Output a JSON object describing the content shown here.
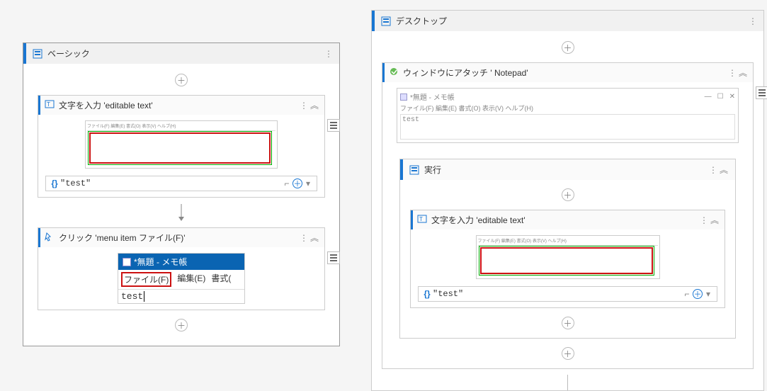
{
  "left": {
    "title": "ベーシック",
    "type_text": {
      "title": "文字を入力 'editable text'",
      "preview_menu": "ファイル(F)  編集(E)  書式(O)  表示(V)  ヘルプ(H)",
      "value": "\"test\""
    },
    "click": {
      "title": "クリック 'menu item  ファイル(F)'",
      "notepad_title": "*無題 - メモ帳",
      "menu_file": "ファイル(F)",
      "menu_edit": "編集(E)",
      "menu_format": "書式(",
      "body_text": "test"
    }
  },
  "right": {
    "title": "デスクトップ",
    "attach": {
      "title": "ウィンドウにアタッチ '      Notepad'",
      "np_title": "*無題 - メモ帳",
      "np_menu": "ファイル(F)  編集(E)  書式(O)  表示(V)  ヘルプ(H)",
      "np_body": "test"
    },
    "exec": {
      "title": "実行",
      "type_text": {
        "title": "文字を入力 'editable text'",
        "preview_menu": "ファイル(F)  編集(E)  書式(O)  表示(V)  ヘルプ(H)",
        "value": "\"test\""
      }
    }
  }
}
